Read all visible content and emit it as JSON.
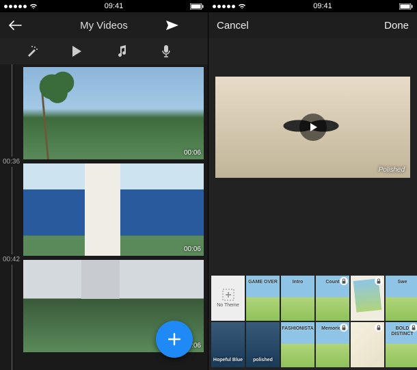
{
  "status": {
    "time": "09:41"
  },
  "left": {
    "nav": {
      "title": "My Videos"
    },
    "timemarks": [
      "00:36",
      "00:42"
    ],
    "clips": [
      {
        "duration": "00:06"
      },
      {
        "duration": "00:06"
      },
      {
        "duration": "00:06"
      }
    ]
  },
  "right": {
    "nav": {
      "cancel": "Cancel",
      "done": "Done"
    },
    "preview": {
      "theme_label": "Polished"
    },
    "themes_row1": [
      {
        "label": "No Theme",
        "none": true,
        "locked": false
      },
      {
        "label": "GAME OVER",
        "locked": false
      },
      {
        "label": "Intro",
        "locked": false
      },
      {
        "label": "Count",
        "locked": true
      },
      {
        "label": "",
        "polaroid": true,
        "locked": true
      },
      {
        "label": "Swe",
        "locked": false
      }
    ],
    "themes_row2": [
      {
        "label": "Hopeful Blue",
        "dark": true,
        "locked": false
      },
      {
        "label": "polished",
        "dark": true,
        "locked": false
      },
      {
        "label": "FASHIONISTA",
        "locked": false
      },
      {
        "label": "Memories",
        "locked": true
      },
      {
        "label": "",
        "paper": true,
        "locked": true
      },
      {
        "label": "BOLD DISTINCT",
        "locked": true
      }
    ]
  }
}
